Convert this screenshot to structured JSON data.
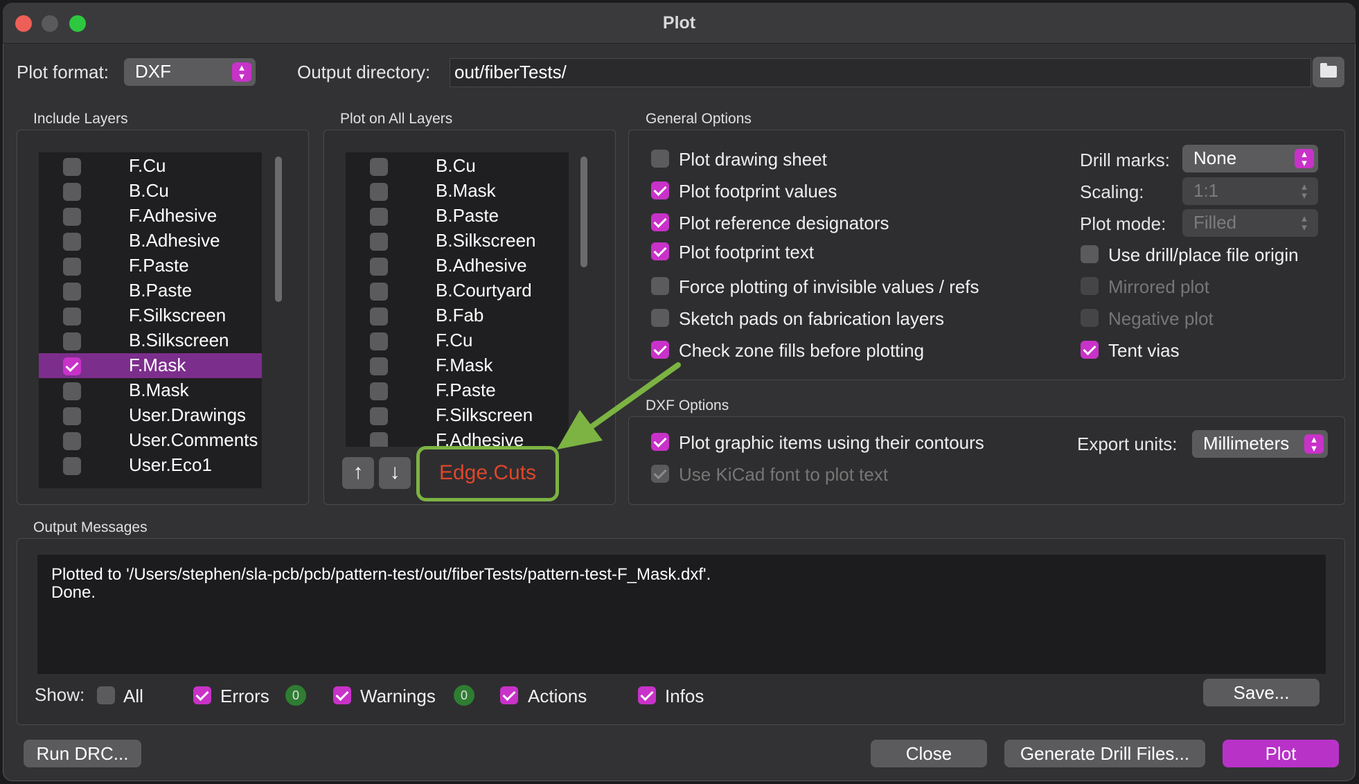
{
  "window": {
    "title": "Plot"
  },
  "top": {
    "plot_format_label": "Plot format:",
    "plot_format_value": "DXF",
    "output_dir_label": "Output directory:",
    "output_dir_value": "out/fiberTests/"
  },
  "include_layers": {
    "title": "Include Layers",
    "items": [
      {
        "label": "F.Cu",
        "checked": false
      },
      {
        "label": "B.Cu",
        "checked": false
      },
      {
        "label": "F.Adhesive",
        "checked": false
      },
      {
        "label": "B.Adhesive",
        "checked": false
      },
      {
        "label": "F.Paste",
        "checked": false
      },
      {
        "label": "B.Paste",
        "checked": false
      },
      {
        "label": "F.Silkscreen",
        "checked": false
      },
      {
        "label": "B.Silkscreen",
        "checked": false
      },
      {
        "label": "F.Mask",
        "checked": true,
        "selected": true
      },
      {
        "label": "B.Mask",
        "checked": false
      },
      {
        "label": "User.Drawings",
        "checked": false
      },
      {
        "label": "User.Comments",
        "checked": false
      },
      {
        "label": "User.Eco1",
        "checked": false
      }
    ]
  },
  "all_layers": {
    "title": "Plot on All Layers",
    "items": [
      {
        "label": "B.Cu",
        "checked": false
      },
      {
        "label": "B.Mask",
        "checked": false
      },
      {
        "label": "B.Paste",
        "checked": false
      },
      {
        "label": "B.Silkscreen",
        "checked": false
      },
      {
        "label": "B.Adhesive",
        "checked": false
      },
      {
        "label": "B.Courtyard",
        "checked": false
      },
      {
        "label": "B.Fab",
        "checked": false
      },
      {
        "label": "F.Cu",
        "checked": false
      },
      {
        "label": "F.Mask",
        "checked": false
      },
      {
        "label": "F.Paste",
        "checked": false
      },
      {
        "label": "F.Silkscreen",
        "checked": false
      },
      {
        "label": "F.Adhesive",
        "checked": false
      }
    ],
    "up_icon": "↑",
    "down_icon": "↓",
    "highlight_label": "Edge.Cuts"
  },
  "general": {
    "title": "General Options",
    "left_options": [
      {
        "label": "Plot drawing sheet",
        "checked": false
      },
      {
        "label": "Plot footprint values",
        "checked": true
      },
      {
        "label": "Plot reference designators",
        "checked": true
      },
      {
        "label": "Plot footprint text",
        "checked": true
      },
      {
        "label": "Force plotting of invisible values / refs",
        "checked": false
      },
      {
        "label": "Sketch pads on fabrication layers",
        "checked": false
      },
      {
        "label": "Check zone fills before plotting",
        "checked": true
      }
    ],
    "drill_marks_label": "Drill marks:",
    "drill_marks_value": "None",
    "scaling_label": "Scaling:",
    "scaling_value": "1:1",
    "plot_mode_label": "Plot mode:",
    "plot_mode_value": "Filled",
    "right_options": [
      {
        "label": "Use drill/place file origin",
        "checked": false,
        "disabled": false
      },
      {
        "label": "Mirrored plot",
        "checked": false,
        "disabled": true
      },
      {
        "label": "Negative plot",
        "checked": false,
        "disabled": true
      },
      {
        "label": "Tent vias",
        "checked": true,
        "disabled": false
      }
    ]
  },
  "dxf": {
    "title": "DXF Options",
    "contours_label": "Plot graphic items using their contours",
    "contours_checked": true,
    "kicad_font_label": "Use KiCad font to plot text",
    "kicad_font_checked": true,
    "export_units_label": "Export units:",
    "export_units_value": "Millimeters"
  },
  "messages": {
    "title": "Output Messages",
    "text": "Plotted to '/Users/stephen/sla-pcb/pcb/pattern-test/out/fiberTests/pattern-test-F_Mask.dxf'.\nDone.",
    "show_label": "Show:",
    "filter_all": "All",
    "filter_errors": "Errors",
    "errors_count": "0",
    "filter_warnings": "Warnings",
    "warnings_count": "0",
    "filter_actions": "Actions",
    "filter_infos": "Infos",
    "save_label": "Save..."
  },
  "footer": {
    "run_drc": "Run DRC...",
    "close": "Close",
    "generate_drill": "Generate Drill Files...",
    "plot": "Plot"
  },
  "colors": {
    "accent": "#c832c8",
    "selection": "#7c2e8c",
    "annotation_green": "#7cb342",
    "highlight_text": "#e0452a"
  }
}
